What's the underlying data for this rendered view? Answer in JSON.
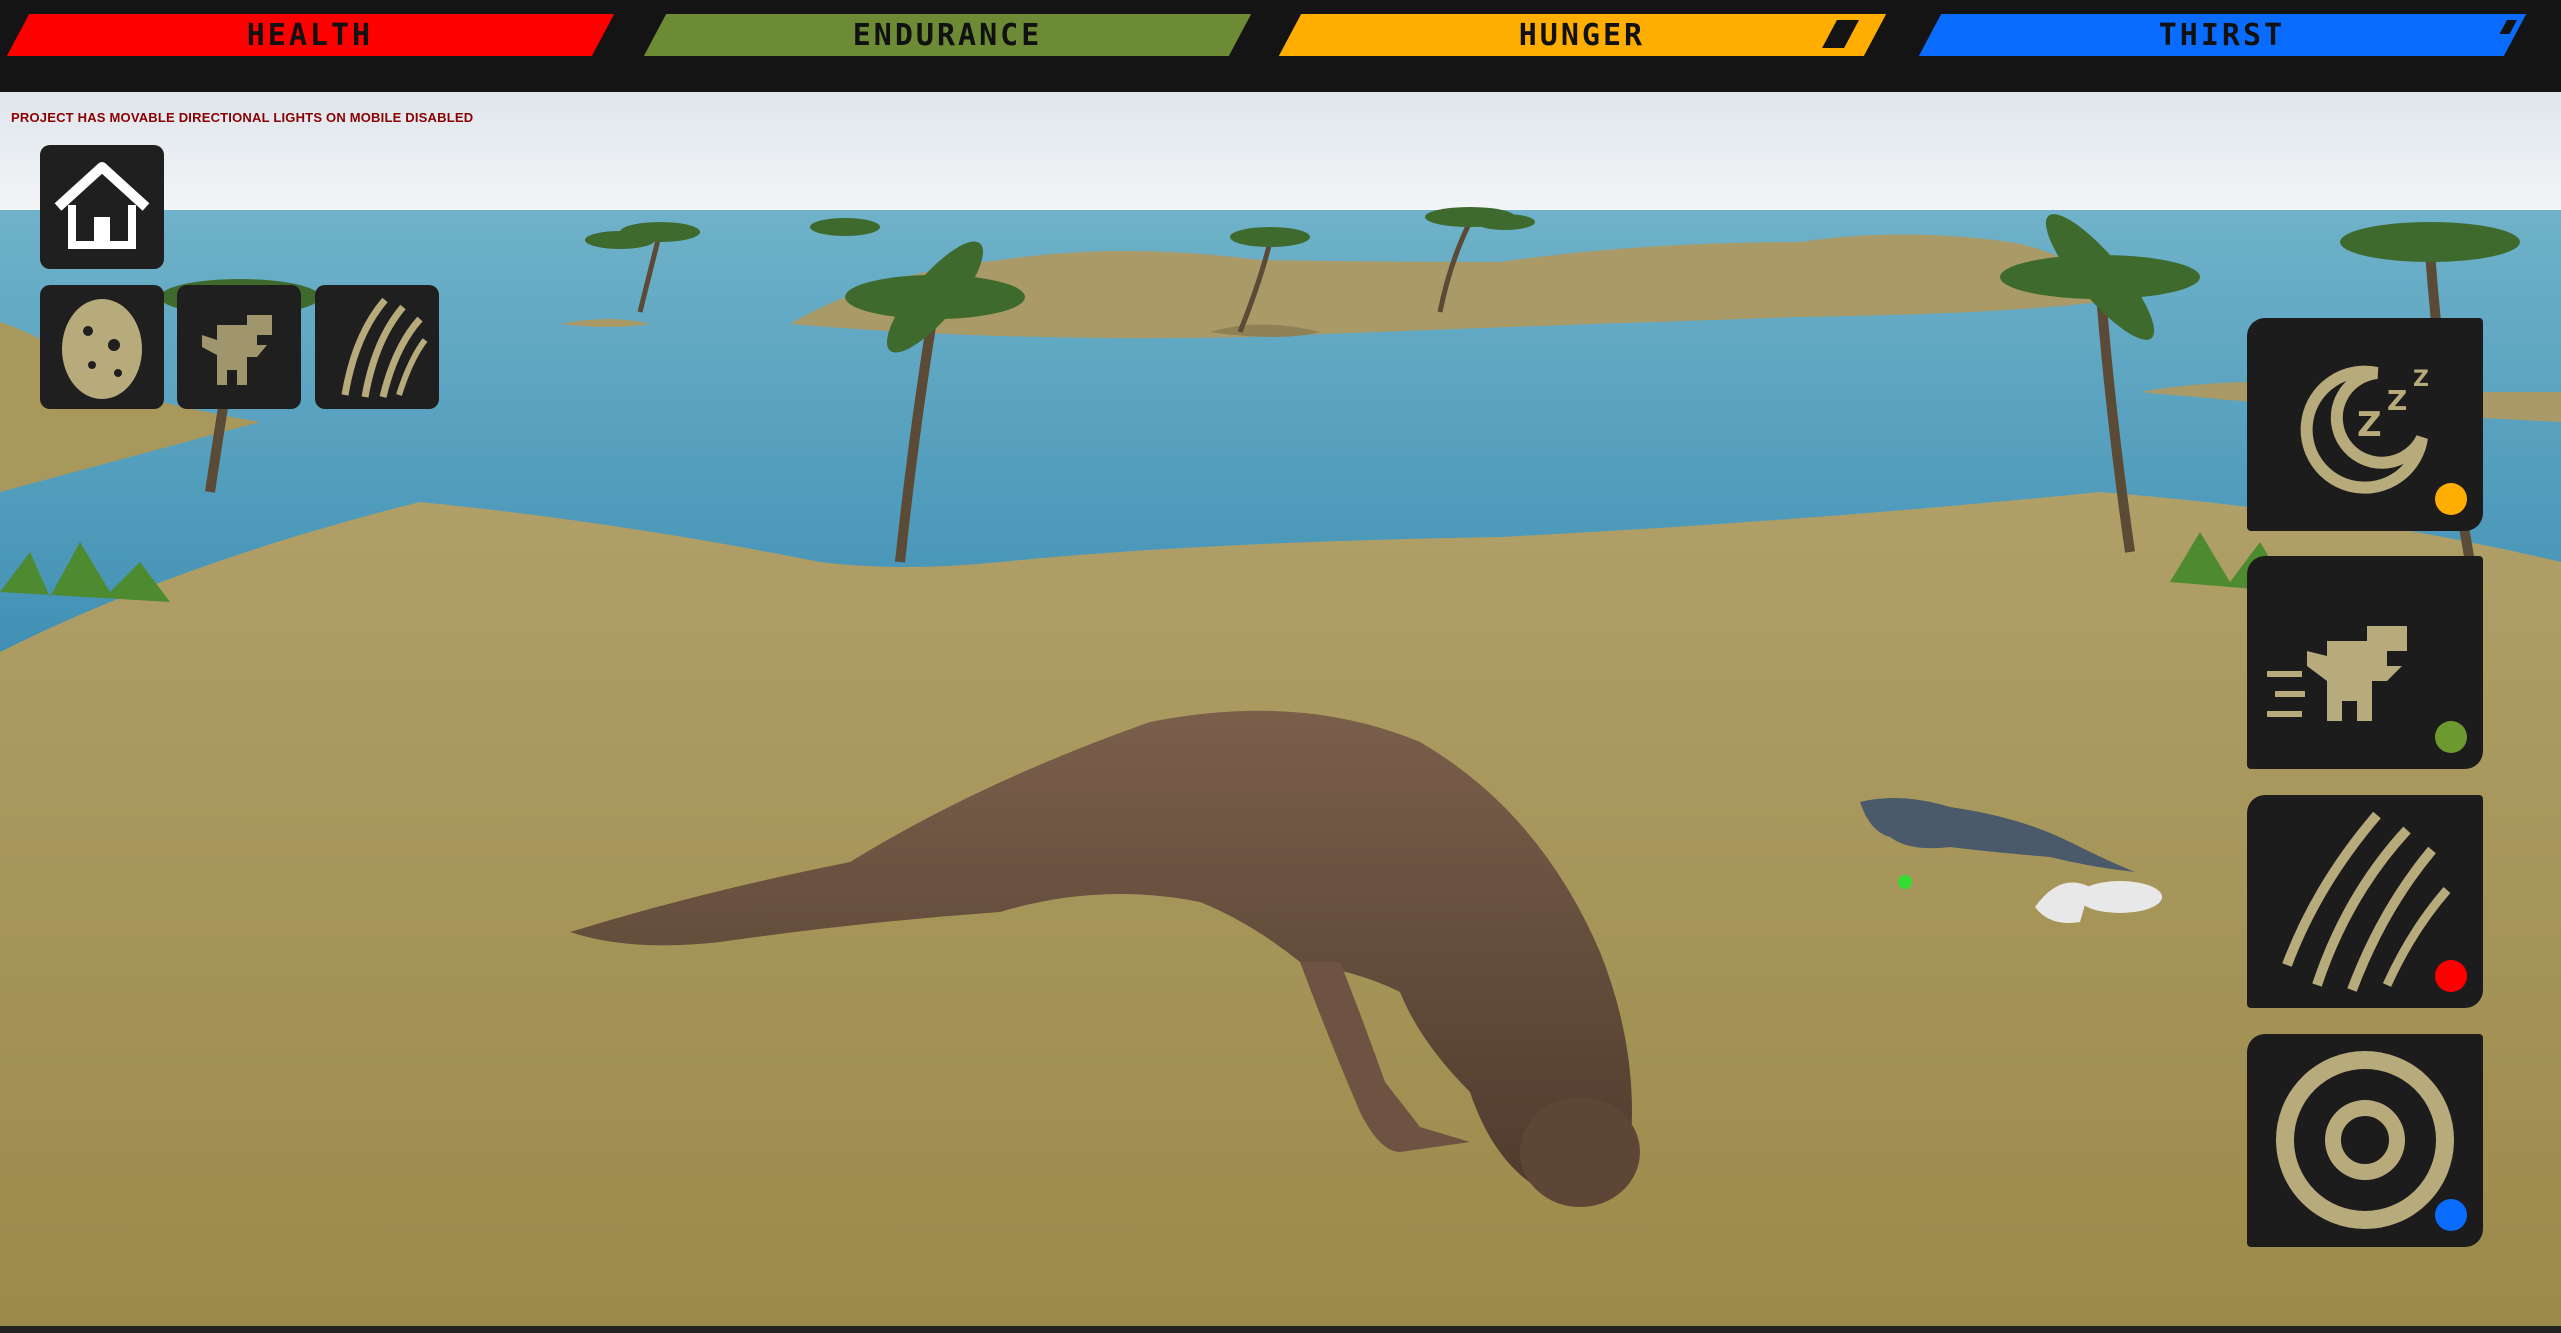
{
  "stats": {
    "health": {
      "label": "HEALTH",
      "color": "#ff0000"
    },
    "endurance": {
      "label": "ENDURANCE",
      "color": "#6d8a35"
    },
    "hunger": {
      "label": "HUNGER",
      "color": "#ffae00"
    },
    "thirst": {
      "label": "THIRST",
      "color": "#0a6cff"
    }
  },
  "debug_message": "PROJECT HAS MOVABLE DIRECTIONAL LIGHTS ON MOBILE DISABLED",
  "left_buttons": [
    {
      "icon": "home-icon"
    },
    {
      "icon": "egg-icon"
    },
    {
      "icon": "dino-run-icon"
    },
    {
      "icon": "claw-icon"
    }
  ],
  "right_actions": [
    {
      "icon": "sleep-moon-icon",
      "indicator_color": "#ffae00"
    },
    {
      "icon": "dino-sprint-icon",
      "indicator_color": "#6d9a2e"
    },
    {
      "icon": "claw-attack-icon",
      "indicator_color": "#ff0000"
    },
    {
      "icon": "target-icon",
      "indicator_color": "#0a6cff"
    }
  ]
}
